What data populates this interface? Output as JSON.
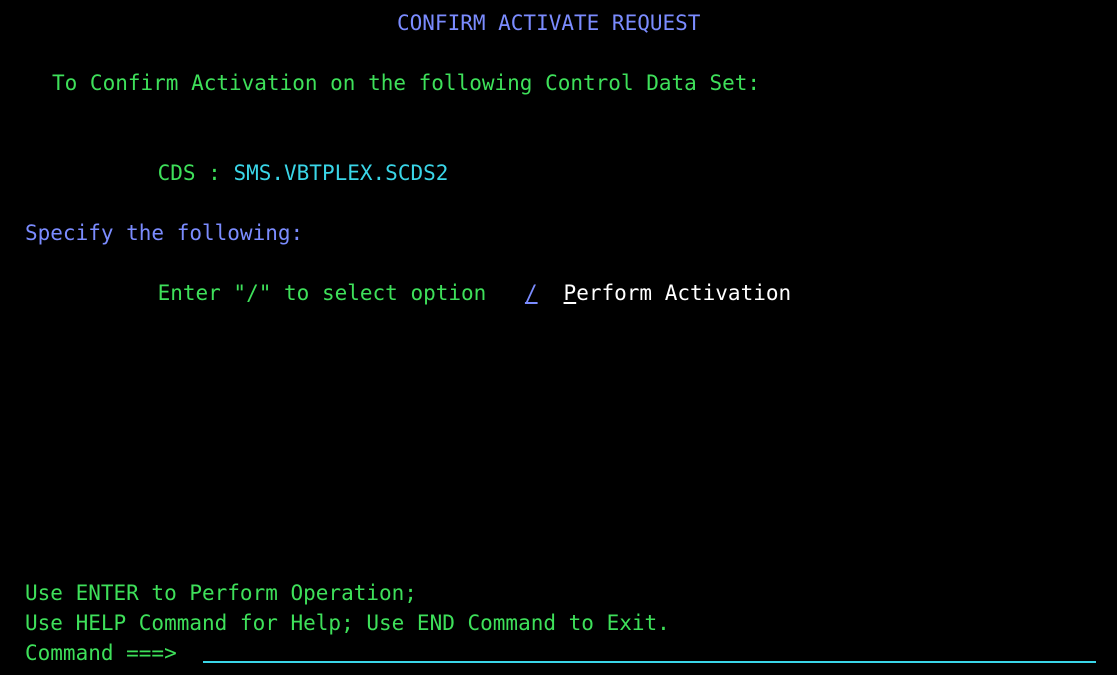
{
  "panel": {
    "title": "CONFIRM ACTIVATE REQUEST",
    "intro": "To Confirm Activation on the following Control Data Set:",
    "cds_label": "CDS :",
    "cds_value": "SMS.VBTPLEX.SCDS2",
    "specify_label": "Specify the following:",
    "option_prompt": "Enter \"/\" to select option",
    "option_value": "/",
    "option_label_first": "P",
    "option_label_rest": "erform Activation",
    "footer_line1": "Use ENTER to Perform Operation;",
    "footer_line2": "Use HELP Command for Help; Use END Command to Exit.",
    "command_label": "Command ===>",
    "command_value": ""
  },
  "colors": {
    "background": "#000000",
    "title": "#7b8cff",
    "text": "#3ee05a",
    "value": "#3ad6e8",
    "highlight": "#ffffff"
  }
}
